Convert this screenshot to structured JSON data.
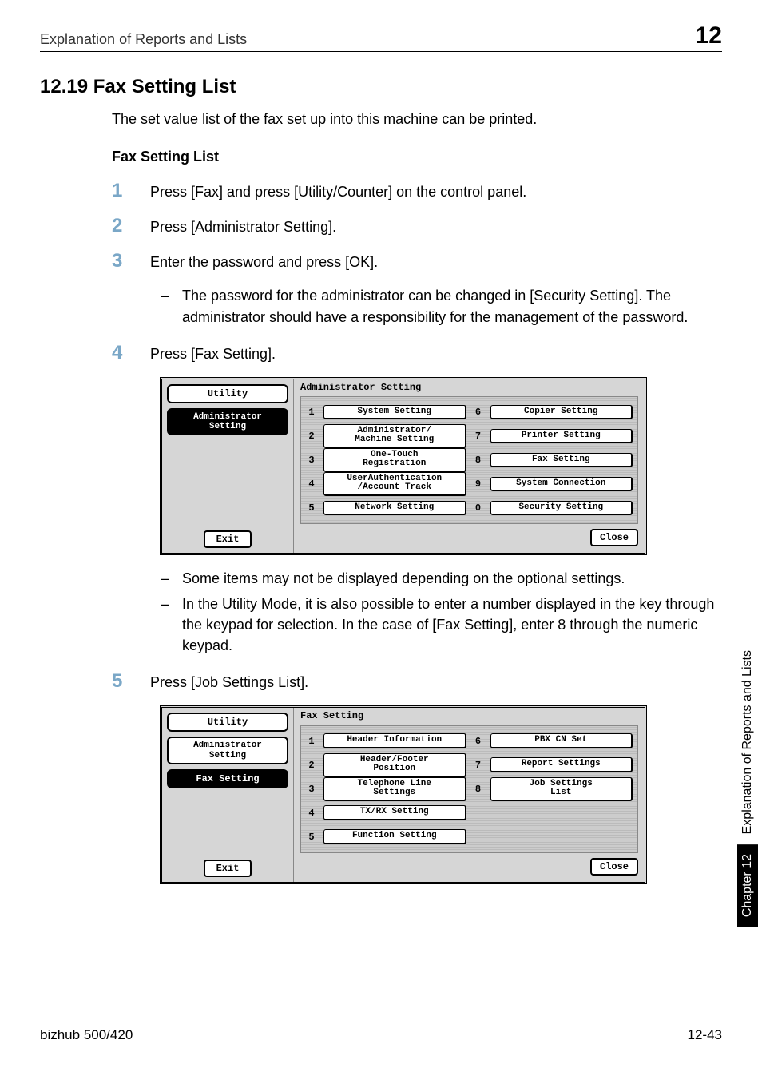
{
  "header": {
    "title": "Explanation of Reports and Lists",
    "chapter_num": "12"
  },
  "section": {
    "heading": "12.19  Fax Setting List",
    "intro": "The set value list of the fax set up into this machine can be printed.",
    "sub_heading": "Fax Setting List"
  },
  "steps": {
    "s1": {
      "num": "1",
      "text": "Press [Fax] and press [Utility/Counter] on the control panel."
    },
    "s2": {
      "num": "2",
      "text": "Press [Administrator Setting]."
    },
    "s3": {
      "num": "3",
      "text": "Enter the password and press [OK]."
    },
    "s3_note": "The password for the administrator can be changed in [Security Setting]. The administrator should have a responsibility for the management of the password.",
    "s4": {
      "num": "4",
      "text": "Press [Fax Setting]."
    },
    "s4_note_a": "Some items may not be displayed depending on the optional settings.",
    "s4_note_b": "In the Utility Mode, it is also possible to enter a number displayed in the key through the keypad for selection. In the case of [Fax Setting], enter 8 through the numeric keypad.",
    "s5": {
      "num": "5",
      "text": "Press [Job Settings List]."
    }
  },
  "panel1": {
    "left_utility": "Utility",
    "left_selected": "Administrator\nSetting",
    "title": "Administrator\nSetting",
    "exit": "Exit",
    "close": "Close",
    "items": [
      {
        "n": "1",
        "l": "System Setting"
      },
      {
        "n": "2",
        "l": "Administrator/\nMachine Setting"
      },
      {
        "n": "3",
        "l": "One-Touch\nRegistration"
      },
      {
        "n": "4",
        "l": "UserAuthentication\n/Account Track"
      },
      {
        "n": "5",
        "l": "Network Setting"
      },
      {
        "n": "6",
        "l": "Copier Setting"
      },
      {
        "n": "7",
        "l": "Printer Setting"
      },
      {
        "n": "8",
        "l": "Fax Setting"
      },
      {
        "n": "9",
        "l": "System Connection"
      },
      {
        "n": "0",
        "l": "Security Setting"
      }
    ]
  },
  "panel2": {
    "left_utility": "Utility",
    "left_mid": "Administrator\nSetting",
    "left_selected": "Fax Setting",
    "title": "Fax Setting",
    "exit": "Exit",
    "close": "Close",
    "items": [
      {
        "n": "1",
        "l": "Header Information"
      },
      {
        "n": "2",
        "l": "Header/Footer\nPosition"
      },
      {
        "n": "3",
        "l": "Telephone Line\nSettings"
      },
      {
        "n": "4",
        "l": "TX/RX Setting"
      },
      {
        "n": "5",
        "l": "Function Setting"
      },
      {
        "n": "6",
        "l": "PBX CN Set"
      },
      {
        "n": "7",
        "l": "Report Settings"
      },
      {
        "n": "8",
        "l": "Job Settings\nList"
      }
    ]
  },
  "sidebar": {
    "black": "Chapter 12",
    "white": "Explanation of Reports and Lists"
  },
  "footer": {
    "left": "bizhub 500/420",
    "right": "12-43"
  },
  "dash": "–"
}
